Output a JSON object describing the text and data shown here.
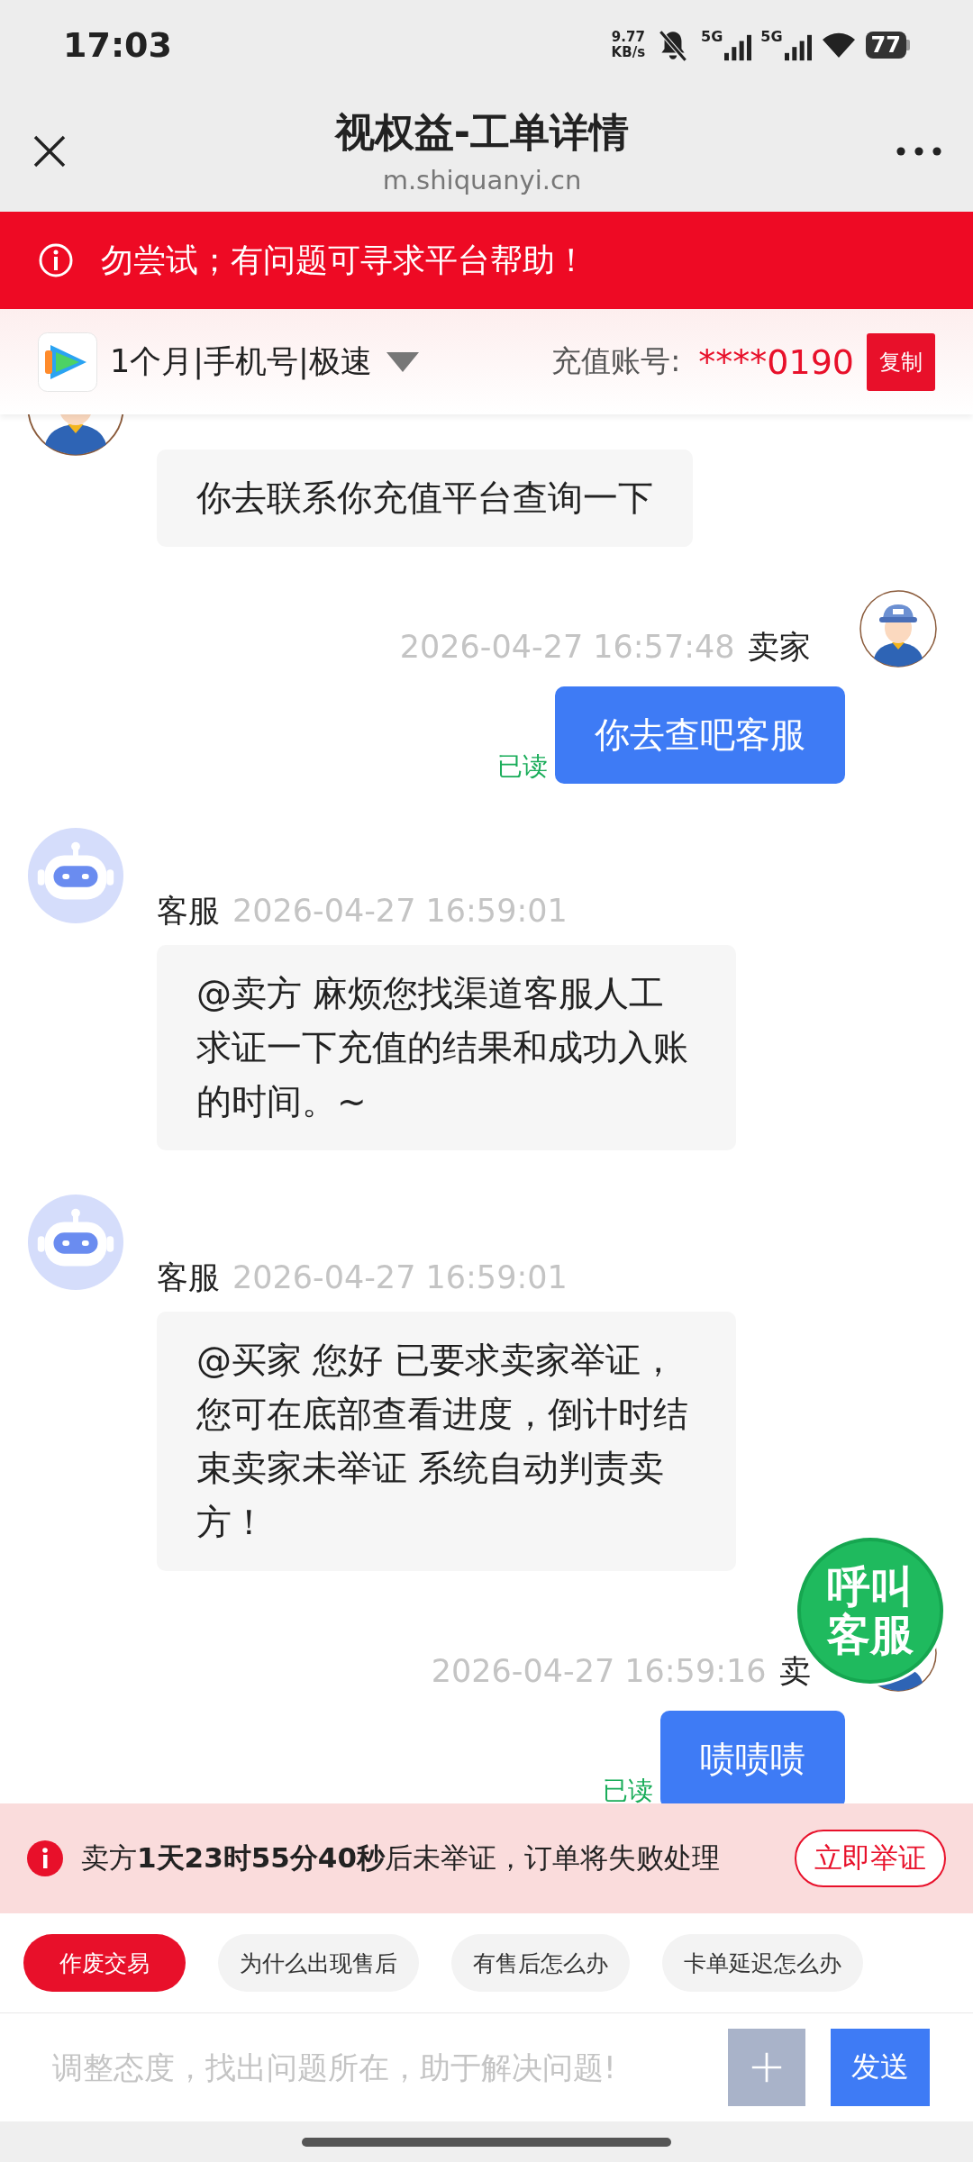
{
  "status_bar": {
    "time": "17:03",
    "net_speed": "9.77",
    "net_unit": "KB/s",
    "signals": [
      "5G",
      "5G"
    ],
    "battery": "77"
  },
  "header": {
    "title": "视权益-工单详情",
    "url": "m.shiquanyi.cn"
  },
  "alert": {
    "text": "勿尝试；有问题可寻求平台帮助！"
  },
  "product": {
    "name": "1个月|手机号|极速",
    "account_label": "充值账号:",
    "account": "****0190",
    "copy_button": "复制"
  },
  "messages": [
    {
      "kind": "peer",
      "clipped": true,
      "text": "你去联系你充值平台查询一下"
    },
    {
      "kind": "self",
      "clipped": false,
      "sender": "卖家",
      "time": "2026-04-27 16:57:48",
      "text": "你去查吧客服",
      "status": "已读"
    },
    {
      "kind": "bot",
      "clipped": false,
      "sender": "客服",
      "time": "2026-04-27 16:59:01",
      "text": "@卖方 麻烦您找渠道客服人工求证一下充值的结果和成功入账的时间。~"
    },
    {
      "kind": "bot",
      "clipped": false,
      "sender": "客服",
      "time": "2026-04-27 16:59:01",
      "text": "@买家 您好 已要求卖家举证，您可在底部查看进度，倒计时结束卖家未举证 系统自动判责卖方！"
    },
    {
      "kind": "self",
      "clipped": false,
      "sender": "卖",
      "time": "2026-04-27 16:59:16",
      "text": "啧啧啧",
      "status": "已读"
    }
  ],
  "call_button": "呼叫客服",
  "warning": {
    "text": "卖方**1天23时55分40秒**后未举证，订单将失败处理",
    "button": "立即举证"
  },
  "quick_replies": [
    {
      "label": "作废交易",
      "kind": "danger"
    },
    {
      "label": "为什么出现售后",
      "kind": "normal"
    },
    {
      "label": "有售后怎么办",
      "kind": "normal"
    },
    {
      "label": "卡单延迟怎么办",
      "kind": "normal"
    }
  ],
  "composer": {
    "placeholder": "调整态度，找出问题所在，助于解决问题!",
    "send_button": "发送"
  }
}
